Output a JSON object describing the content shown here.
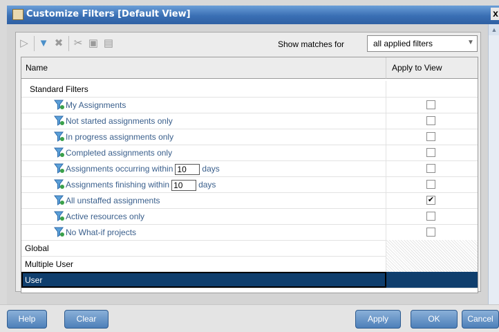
{
  "window": {
    "title": "Customize Filters [Default View]",
    "close_glyph": "x",
    "app_icon": "java-cup-icon"
  },
  "toolbar": {
    "icons": [
      "filter-icon",
      "add-filter-icon",
      "delete-icon",
      "cut-icon",
      "copy-icon",
      "paste-icon"
    ],
    "show_matches_label": "Show matches for",
    "show_matches_value": "all applied filters"
  },
  "table": {
    "headers": {
      "name": "Name",
      "apply": "Apply to View"
    },
    "standard_filters_label": "Standard Filters",
    "items": [
      {
        "label": "My Assignments",
        "checked": false
      },
      {
        "label": "Not started assignments only",
        "checked": false
      },
      {
        "label": "In progress assignments only",
        "checked": false
      },
      {
        "label": "Completed assignments only",
        "checked": false
      },
      {
        "label_before": "Assignments occurring within",
        "input_value": "10",
        "label_after": "days",
        "checked": false
      },
      {
        "label_before": "Assignments finishing within",
        "input_value": "10",
        "label_after": "days",
        "checked": false
      },
      {
        "label": "All unstaffed assignments",
        "checked": true
      },
      {
        "label": "Active resources  only",
        "checked": false
      },
      {
        "label": "No What-if projects",
        "checked": false
      }
    ],
    "categories": [
      "Global",
      "Multiple User",
      "User"
    ],
    "check_glyph": "✔"
  },
  "buttons": {
    "help": "Help",
    "clear": "Clear",
    "apply": "Apply",
    "ok": "OK",
    "cancel": "Cancel"
  },
  "colors": {
    "title_bar": "#3a6fb4",
    "selected_row": "#0f3e6d",
    "item_text": "#3a5f8c",
    "button": "#4d7fb9"
  }
}
